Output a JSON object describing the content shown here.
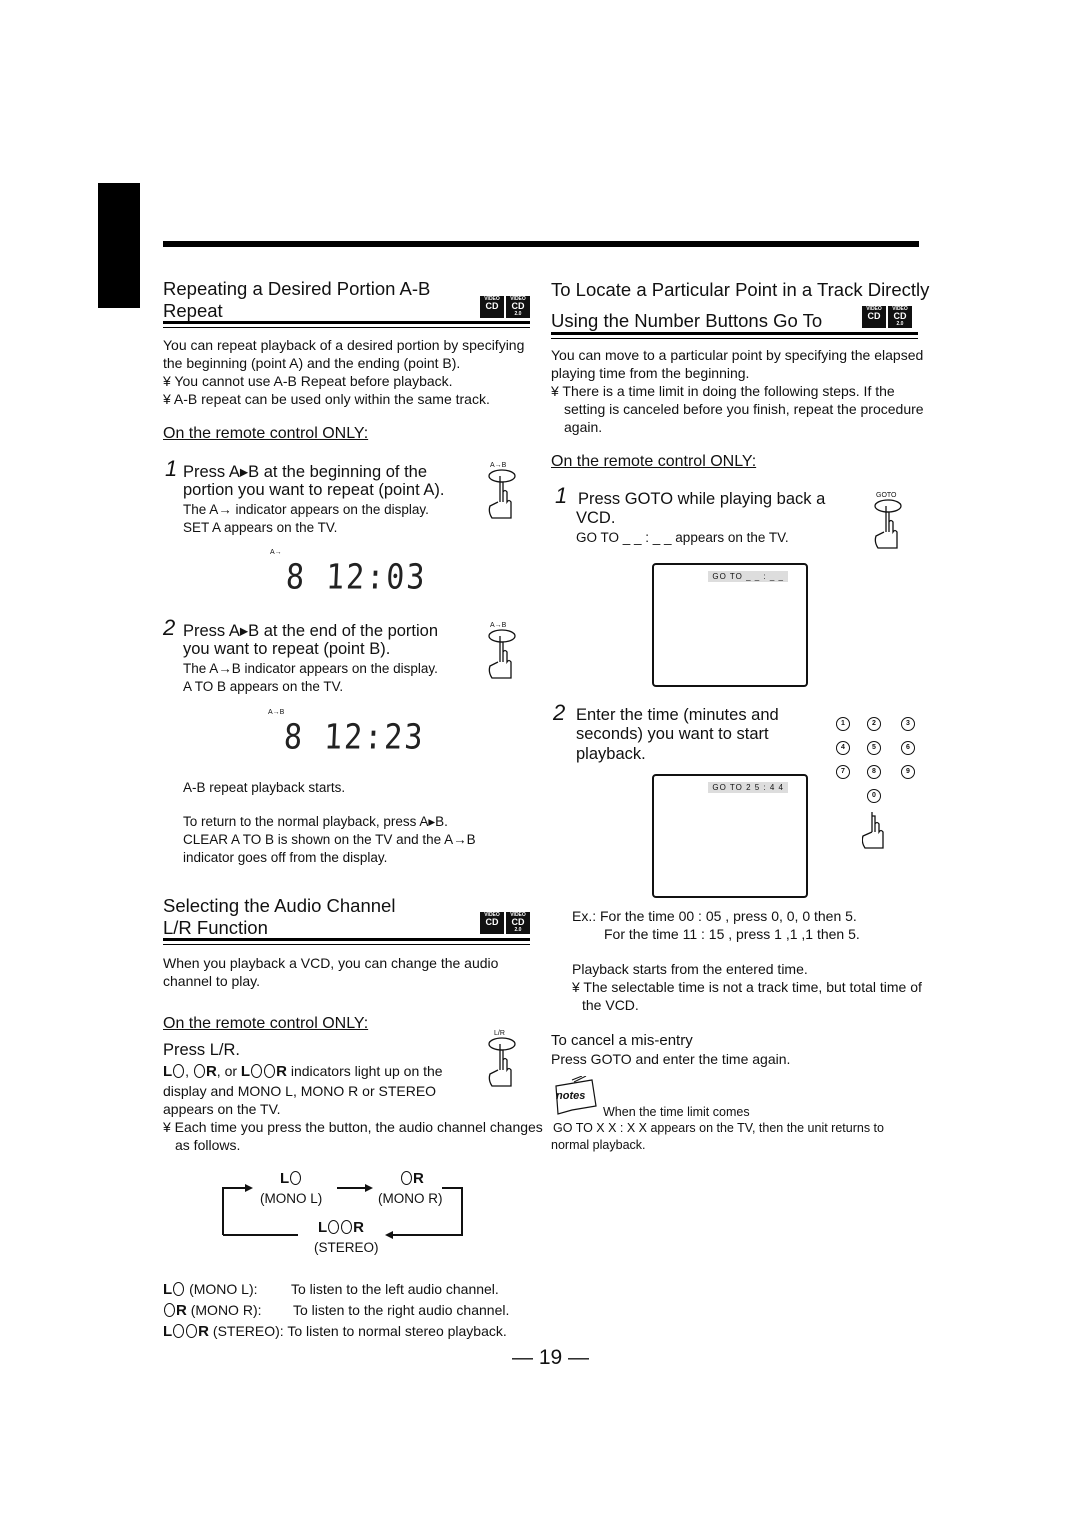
{
  "page_number": "— 19 —",
  "badges": {
    "top": "VIDEO",
    "cd": "CD",
    "ver": "2.0"
  },
  "left": {
    "ab": {
      "title_1": "Repeating  a  Desired  Portion  A-B",
      "title_2": "Repeat",
      "intro_1": "You can repeat playback of a desired portion by specifying",
      "intro_2": "the beginning (point A) and the ending (point B).",
      "bullet_1": "¥  You cannot use A-B Repeat before playback.",
      "bullet_2": "¥ A-B repeat can be used only within the same track.",
      "remote_only": "On the remote control ONLY:",
      "step1_num": "1",
      "step1_1": "Press A▸B at the beginning of the",
      "step1_2": "portion you want to repeat (point A).",
      "step1_3": "The A→ indicator appears on the display.",
      "step1_4": " SET A  appears on the TV.",
      "btn_label": "A→B",
      "display1_ind": "A→",
      "display1": "8  12:03",
      "step2_num": "2",
      "step2_1": "Press A▸B at the end of the portion",
      "step2_2": "you want to repeat (point B).",
      "step2_3": "The A→B indicator appears on the display.",
      "step2_4": " A TO B  appears on the TV.",
      "display2_ind": "A→B",
      "display2": "8  12:23",
      "starts": "A-B repeat playback starts.",
      "return_1": "To return to the normal playback, press A▸B.",
      "return_2": " CLEAR A TO B  is shown on the TV and the A→B",
      "return_3": "indicator goes off from the display."
    },
    "audio": {
      "title_1": "Selecting the Audio Channel",
      "title_2": "L/R Function",
      "intro_1": "When you playback a VCD, you can change the audio",
      "intro_2": "channel to play.",
      "remote_only": "On the remote control ONLY:",
      "press": "Press L/R.",
      "btn_label": "L/R",
      "ind_1": ", or",
      "ind_2": "indicators light up on the",
      "ind_3": "display and  MONO L,   MONO R  or  STEREO",
      "ind_4": "appears on the TV.",
      "bullet_1": "¥ Each time you press the button, the audio channel changes",
      "bullet_2": "as follows.",
      "cycle": {
        "mono_l": "(MONO  L)",
        "mono_r": "(MONO  R)",
        "stereo": "(STEREO)"
      },
      "legend": [
        {
          "label": "(MONO L):",
          "desc": "To listen to the left audio channel."
        },
        {
          "label": "(MONO R):",
          "desc": "To listen to the right audio channel."
        },
        {
          "label": "(STEREO):",
          "desc": "To listen to normal stereo playback."
        }
      ]
    }
  },
  "right": {
    "title_1": "To Locate a Particular Point in a Track Directly",
    "title_2": "Using the Number Buttons Go To",
    "intro_1": "You can move to a particular point by specifying the elapsed",
    "intro_2": "playing time from the beginning.",
    "bullet_1": "¥  There is a time limit in doing the following steps. If the",
    "bullet_2": "setting is canceled before you finish, repeat the procedure",
    "bullet_3": "again.",
    "remote_only": "On the remote control ONLY:",
    "step1_num": "1",
    "step1_1": "Press GOTO while playing back a",
    "step1_2": "VCD.",
    "step1_3": "GO TO _ _ : _ _  appears on the TV.",
    "btn_label": "GOTO",
    "tv1": "GO TO _ _ : _ _",
    "step2_num": "2",
    "step2_1": "Enter the time (minutes and",
    "step2_2": "seconds) you want to start",
    "step2_3": "playback.",
    "tv2": "GO TO 2 5 : 4 4",
    "keys": [
      "1",
      "2",
      "3",
      "4",
      "5",
      "6",
      "7",
      "8",
      "9",
      "0"
    ],
    "ex_1": "Ex.:  For the time  00 : 05 , press 0, 0, 0 then 5.",
    "ex_2": "For the time  11 : 15 , press 1 ,1 ,1 then 5.",
    "starts": "Playback starts from the entered time.",
    "bullet_4": "¥ The selectable time is not a track time, but total time of",
    "bullet_5": "the VCD.",
    "cancel_title": "To cancel a mis-entry",
    "cancel_text": "Press GOTO and enter the time again.",
    "notes_logo": "notes",
    "note_title": "When the time limit comes",
    "note_1": "GO TO X X : X X  appears on the TV, then the unit returns to",
    "note_2": "normal playback."
  }
}
